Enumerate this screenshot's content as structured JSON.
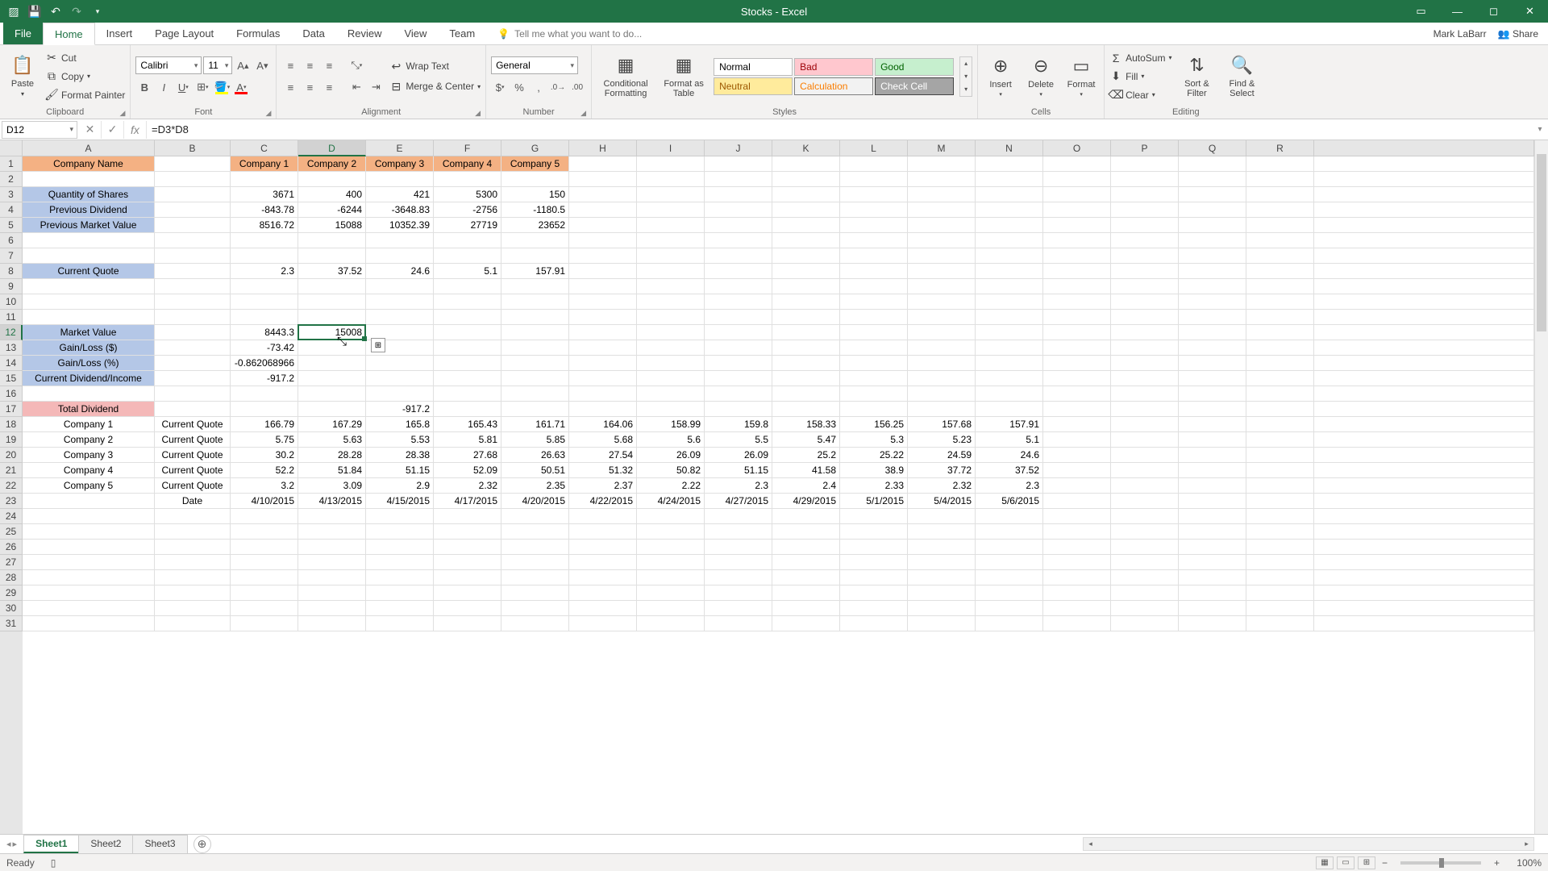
{
  "app": {
    "title": "Stocks - Excel"
  },
  "user": {
    "name": "Mark LaBarr",
    "share": "Share"
  },
  "tabs": [
    "File",
    "Home",
    "Insert",
    "Page Layout",
    "Formulas",
    "Data",
    "Review",
    "View",
    "Team"
  ],
  "active_tab": "Home",
  "tell_me": "Tell me what you want to do...",
  "ribbon": {
    "clipboard": {
      "paste": "Paste",
      "cut": "Cut",
      "copy": "Copy",
      "painter": "Format Painter",
      "label": "Clipboard"
    },
    "font": {
      "name": "Calibri",
      "size": "11",
      "label": "Font"
    },
    "alignment": {
      "wrap": "Wrap Text",
      "merge": "Merge & Center",
      "label": "Alignment"
    },
    "number": {
      "format": "General",
      "label": "Number"
    },
    "styles": {
      "cond": "Conditional Formatting",
      "fat": "Format as Table",
      "normal": "Normal",
      "bad": "Bad",
      "good": "Good",
      "neutral": "Neutral",
      "calc": "Calculation",
      "check": "Check Cell",
      "label": "Styles"
    },
    "cells": {
      "insert": "Insert",
      "delete": "Delete",
      "format": "Format",
      "label": "Cells"
    },
    "editing": {
      "sum": "AutoSum",
      "fill": "Fill",
      "clear": "Clear",
      "sort": "Sort & Filter",
      "find": "Find & Select",
      "label": "Editing"
    }
  },
  "formula_bar": {
    "name_box": "D12",
    "formula": "=D3*D8"
  },
  "columns": [
    "A",
    "B",
    "C",
    "D",
    "E",
    "F",
    "G",
    "H",
    "I",
    "J",
    "K",
    "L",
    "M",
    "N",
    "O",
    "P",
    "Q",
    "R"
  ],
  "col_widths": {
    "A": 164,
    "B": 94,
    "default": 84
  },
  "selected_col": "D",
  "selected_row": 12,
  "data": {
    "1": {
      "A": "Company Name",
      "C": "Company 1",
      "D": "Company 2",
      "E": "Company 3",
      "F": "Company 4",
      "G": "Company 5"
    },
    "3": {
      "A": "Quantity of Shares",
      "C": "3671",
      "D": "400",
      "E": "421",
      "F": "5300",
      "G": "150"
    },
    "4": {
      "A": "Previous Dividend",
      "C": "-843.78",
      "D": "-6244",
      "E": "-3648.83",
      "F": "-2756",
      "G": "-1180.5"
    },
    "5": {
      "A": "Previous Market Value",
      "C": "8516.72",
      "D": "15088",
      "E": "10352.39",
      "F": "27719",
      "G": "23652"
    },
    "8": {
      "A": "Current Quote",
      "C": "2.3",
      "D": "37.52",
      "E": "24.6",
      "F": "5.1",
      "G": "157.91"
    },
    "12": {
      "A": "Market Value",
      "C": "8443.3",
      "D": "15008"
    },
    "13": {
      "A": "Gain/Loss ($)",
      "C": "-73.42"
    },
    "14": {
      "A": "Gain/Loss (%)",
      "C": "-0.862068966"
    },
    "15": {
      "A": "Current Dividend/Income",
      "C": "-917.2"
    },
    "17": {
      "A": "Total Dividend",
      "E": "-917.2"
    },
    "18": {
      "A": "Company 1",
      "B": "Current Quote",
      "C": "166.79",
      "D": "167.29",
      "E": "165.8",
      "F": "165.43",
      "G": "161.71",
      "H": "164.06",
      "I": "158.99",
      "J": "159.8",
      "K": "158.33",
      "L": "156.25",
      "M": "157.68",
      "N": "157.91"
    },
    "19": {
      "A": "Company 2",
      "B": "Current Quote",
      "C": "5.75",
      "D": "5.63",
      "E": "5.53",
      "F": "5.81",
      "G": "5.85",
      "H": "5.68",
      "I": "5.6",
      "J": "5.5",
      "K": "5.47",
      "L": "5.3",
      "M": "5.23",
      "N": "5.1"
    },
    "20": {
      "A": "Company 3",
      "B": "Current Quote",
      "C": "30.2",
      "D": "28.28",
      "E": "28.38",
      "F": "27.68",
      "G": "26.63",
      "H": "27.54",
      "I": "26.09",
      "J": "26.09",
      "K": "25.2",
      "L": "25.22",
      "M": "24.59",
      "N": "24.6"
    },
    "21": {
      "A": "Company 4",
      "B": "Current Quote",
      "C": "52.2",
      "D": "51.84",
      "E": "51.15",
      "F": "52.09",
      "G": "50.51",
      "H": "51.32",
      "I": "50.82",
      "J": "51.15",
      "K": "41.58",
      "L": "38.9",
      "M": "37.72",
      "N": "37.52"
    },
    "22": {
      "A": "Company 5",
      "B": "Current Quote",
      "C": "3.2",
      "D": "3.09",
      "E": "2.9",
      "F": "2.32",
      "G": "2.35",
      "H": "2.37",
      "I": "2.22",
      "J": "2.3",
      "K": "2.4",
      "L": "2.33",
      "M": "2.32",
      "N": "2.3"
    },
    "23": {
      "B": "Date",
      "C": "4/10/2015",
      "D": "4/13/2015",
      "E": "4/15/2015",
      "F": "4/17/2015",
      "G": "4/20/2015",
      "H": "4/22/2015",
      "I": "4/24/2015",
      "J": "4/27/2015",
      "K": "4/29/2015",
      "L": "5/1/2015",
      "M": "5/4/2015",
      "N": "5/6/2015"
    }
  },
  "row_styles": {
    "1": "hdr-orange",
    "3": "hdr-blue",
    "4": "hdr-blue",
    "5": "hdr-blue",
    "8": "hdr-blue",
    "12": "hdr-blue",
    "13": "hdr-blue",
    "14": "hdr-blue",
    "15": "hdr-blue",
    "17": "hdr-red"
  },
  "sheets": {
    "list": [
      "Sheet1",
      "Sheet2",
      "Sheet3"
    ],
    "active": "Sheet1"
  },
  "status": {
    "ready": "Ready",
    "zoom": "100%"
  }
}
